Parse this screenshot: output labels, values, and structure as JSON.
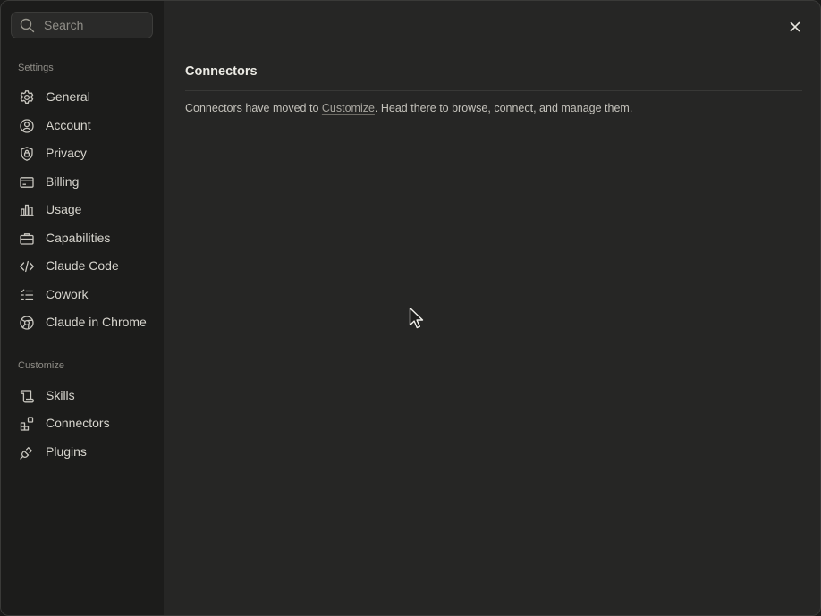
{
  "search": {
    "placeholder": "Search",
    "icon": "search-icon"
  },
  "sidebar": {
    "settings_label": "Settings",
    "settings_items": [
      {
        "label": "General",
        "icon": "gear-icon"
      },
      {
        "label": "Account",
        "icon": "user-circle-icon"
      },
      {
        "label": "Privacy",
        "icon": "shield-lock-icon"
      },
      {
        "label": "Billing",
        "icon": "credit-card-icon"
      },
      {
        "label": "Usage",
        "icon": "bar-chart-icon"
      },
      {
        "label": "Capabilities",
        "icon": "briefcase-icon"
      },
      {
        "label": "Claude Code",
        "icon": "code-icon"
      },
      {
        "label": "Cowork",
        "icon": "checklist-icon"
      },
      {
        "label": "Claude in Chrome",
        "icon": "globe-icon"
      }
    ],
    "customize_label": "Customize",
    "customize_items": [
      {
        "label": "Skills",
        "icon": "scroll-icon"
      },
      {
        "label": "Connectors",
        "icon": "blocks-icon"
      },
      {
        "label": "Plugins",
        "icon": "plug-icon"
      }
    ]
  },
  "main": {
    "title": "Connectors",
    "message_prefix": "Connectors have moved to ",
    "message_link": "Customize",
    "message_suffix": ". Head there to browse, connect, and manage them."
  },
  "close_icon": "close-icon",
  "colors": {
    "window_bg": "#262625",
    "sidebar_bg": "#1c1c1b",
    "text_primary": "#ecebe5",
    "text_muted": "#8f8d87"
  }
}
